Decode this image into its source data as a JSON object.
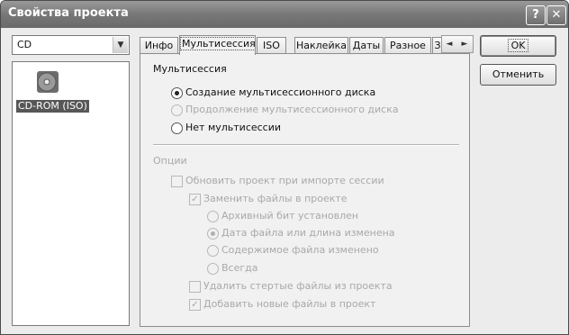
{
  "window": {
    "title": "Свойства проекта",
    "help_label": "?",
    "close_label": "✕"
  },
  "drive_combo": {
    "value": "CD",
    "arrow": "▼"
  },
  "drive_list": {
    "items": [
      {
        "label": "CD-ROM (ISO)",
        "icon": "cd-disc-icon"
      }
    ]
  },
  "tabs": [
    "Инфо",
    "Мультисессия",
    "ISO",
    "Наклейка",
    "Даты",
    "Разное",
    "З"
  ],
  "tab_scroll": {
    "left": "◄",
    "right": "►"
  },
  "multisession": {
    "title": "Мультисессия",
    "options": [
      {
        "label": "Создание мультисессионного диска",
        "selected": true,
        "enabled": true
      },
      {
        "label": "Продолжение мультисессионного диска",
        "selected": false,
        "enabled": false
      },
      {
        "label": "Нет мультисессии",
        "selected": false,
        "enabled": true
      }
    ]
  },
  "options": {
    "title": "Опции",
    "update_on_import": {
      "label": "Обновить проект при импорте сессии",
      "checked": false
    },
    "replace_files": {
      "label": "Заменить файлы в проекте",
      "checked": true
    },
    "replace_modes": [
      {
        "label": "Архивный бит установлен",
        "selected": false
      },
      {
        "label": "Дата файла или длина изменена",
        "selected": true
      },
      {
        "label": "Содержимое файла изменено",
        "selected": false
      },
      {
        "label": "Всегда",
        "selected": false
      }
    ],
    "remove_deleted": {
      "label": "Удалить стертые файлы из проекта",
      "checked": false
    },
    "add_new": {
      "label": "Добавить новые файлы в проект",
      "checked": true
    }
  },
  "buttons": {
    "ok": "OK",
    "cancel": "Отменить"
  }
}
